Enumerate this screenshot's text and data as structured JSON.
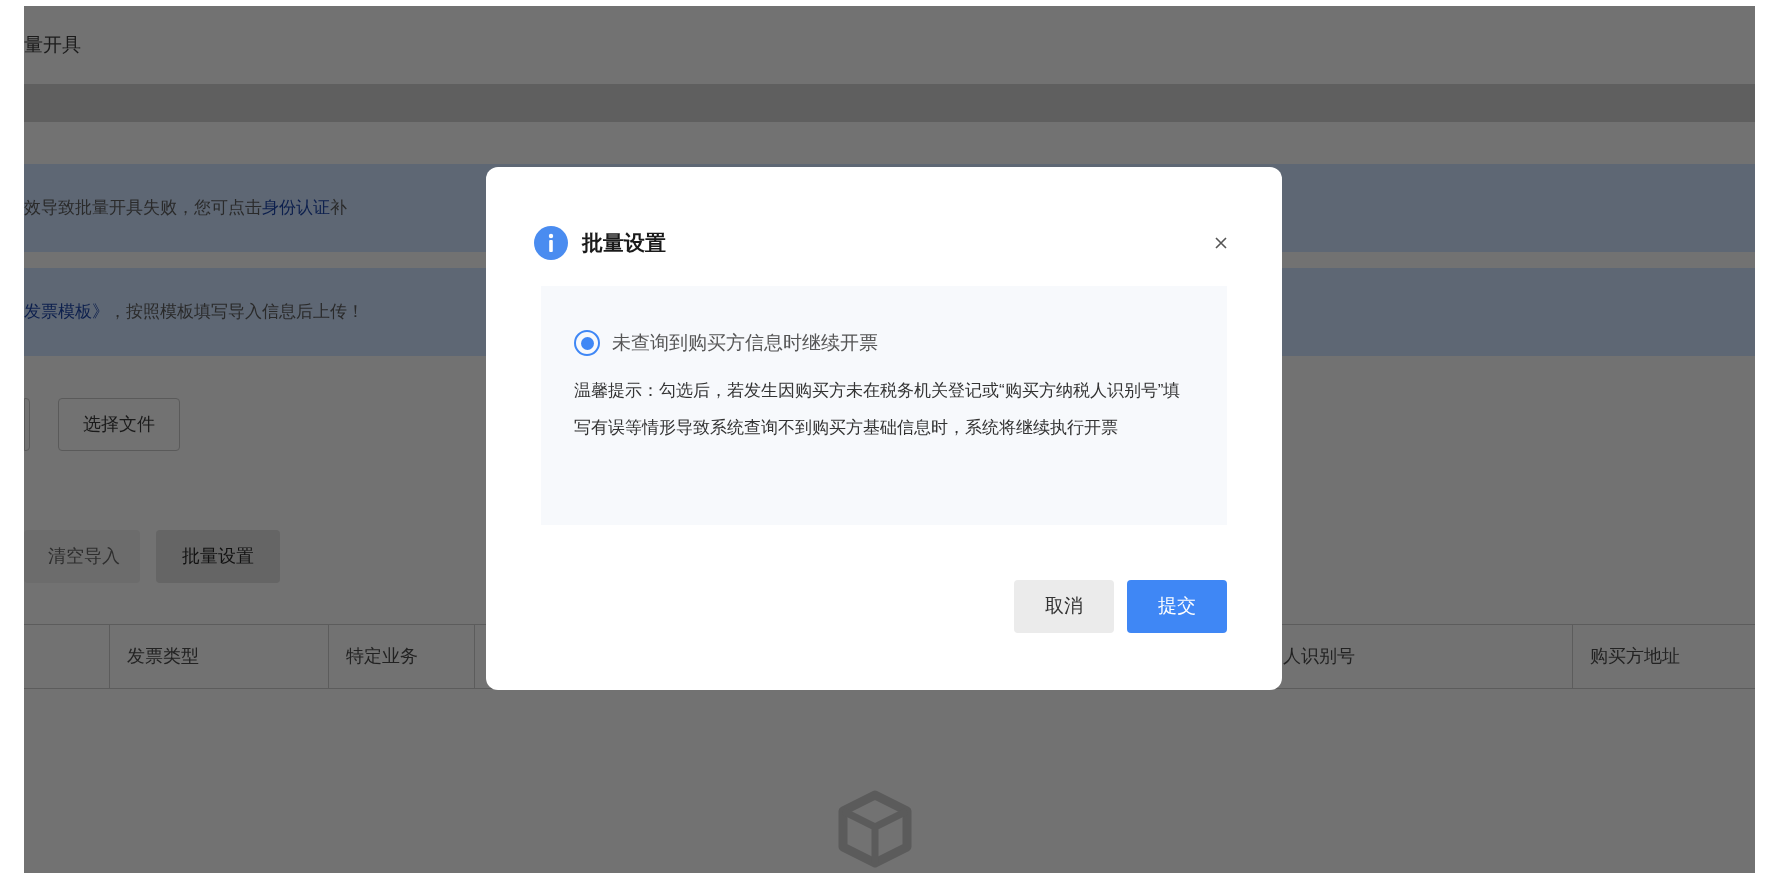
{
  "page": {
    "title": "量开具"
  },
  "alerts": [
    {
      "before": "效导致批量开具失败，您可点击",
      "link": "身份认证",
      "after": "补"
    },
    {
      "link": "发票模板》",
      "after": "，按照模板填写导入信息后上传！"
    }
  ],
  "file_button": "选择文件",
  "actions": [
    {
      "label": "清空导入",
      "disabled": true
    },
    {
      "label": "批量设置",
      "disabled": false
    }
  ],
  "table": {
    "columns": [
      {
        "label": "发票类型"
      },
      {
        "label": "特定业务"
      },
      {
        "label": "人识别号"
      },
      {
        "label": "购买方地址"
      }
    ]
  },
  "dialog": {
    "title": "批量设置",
    "option": {
      "label": "未查询到购买方信息时继续开票",
      "selected": true
    },
    "hint": "温馨提示：勾选后，若发生因购买方未在税务机关登记或“购买方纳税人识别号”填写有误等情形导致系统查询不到购买方基础信息时，系统将继续执行开票",
    "buttons": [
      {
        "label": "取消",
        "kind": "secondary"
      },
      {
        "label": "提交",
        "kind": "primary"
      }
    ]
  }
}
